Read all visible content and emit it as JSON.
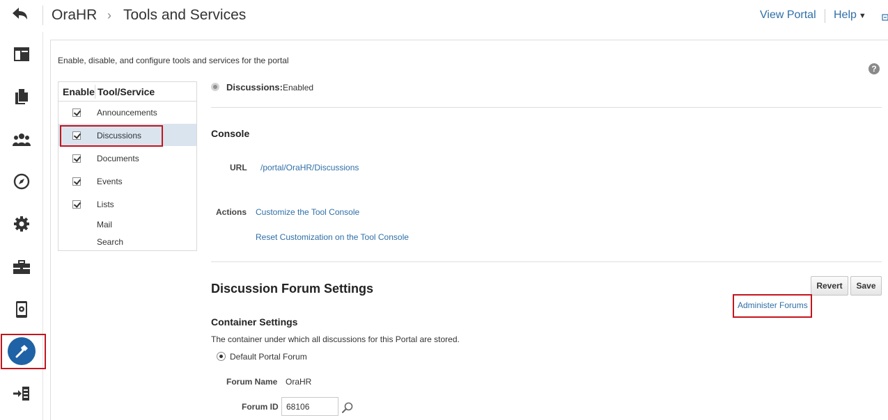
{
  "header": {
    "breadcrumb_root": "OraHR",
    "breadcrumb_sep": "›",
    "page_title": "Tools and Services",
    "view_portal": "View Portal",
    "help": "Help",
    "help_caret": "▼"
  },
  "rail": {
    "icons": [
      "back-icon",
      "layout-icon",
      "pages-icon",
      "members-icon",
      "compass-icon",
      "gear-icon",
      "toolbox-icon",
      "device-settings-icon",
      "hammer-icon",
      "exit-icon"
    ],
    "active": "hammer-icon"
  },
  "main": {
    "intro": "Enable, disable, and configure tools and services for the portal",
    "help_icon": "?",
    "table": {
      "col_enable": "Enable",
      "col_tool": "Tool/Service",
      "rows": [
        {
          "label": "Announcements",
          "checked": true
        },
        {
          "label": "Discussions",
          "checked": true,
          "selected": true
        },
        {
          "label": "Documents",
          "checked": true
        },
        {
          "label": "Events",
          "checked": true
        },
        {
          "label": "Lists",
          "checked": true
        },
        {
          "label": "Mail",
          "checked": false
        },
        {
          "label": "Search",
          "checked": false
        }
      ]
    },
    "detail": {
      "status_label": "Discussions:",
      "status_value": "Enabled",
      "console_title": "Console",
      "url_label": "URL",
      "url_value": "/portal/OraHR/Discussions",
      "actions_label": "Actions",
      "action_customize": "Customize the Tool Console",
      "action_reset": "Reset Customization on the Tool Console",
      "forum_settings_title": "Discussion Forum Settings",
      "revert": "Revert",
      "save": "Save",
      "administer_forums": "Administer Forums",
      "container_title": "Container Settings",
      "container_desc": "The container under which all discussions for this Portal are stored.",
      "default_forum": "Default Portal Forum",
      "forum_name_label": "Forum Name",
      "forum_name_value": "OraHR",
      "forum_id_label": "Forum ID",
      "forum_id_value": "68106"
    }
  },
  "colors": {
    "link": "#2f6fa7",
    "highlight_border": "#c4141c",
    "active_rail": "#1f62a5",
    "selected_row": "#d9e4ef"
  }
}
